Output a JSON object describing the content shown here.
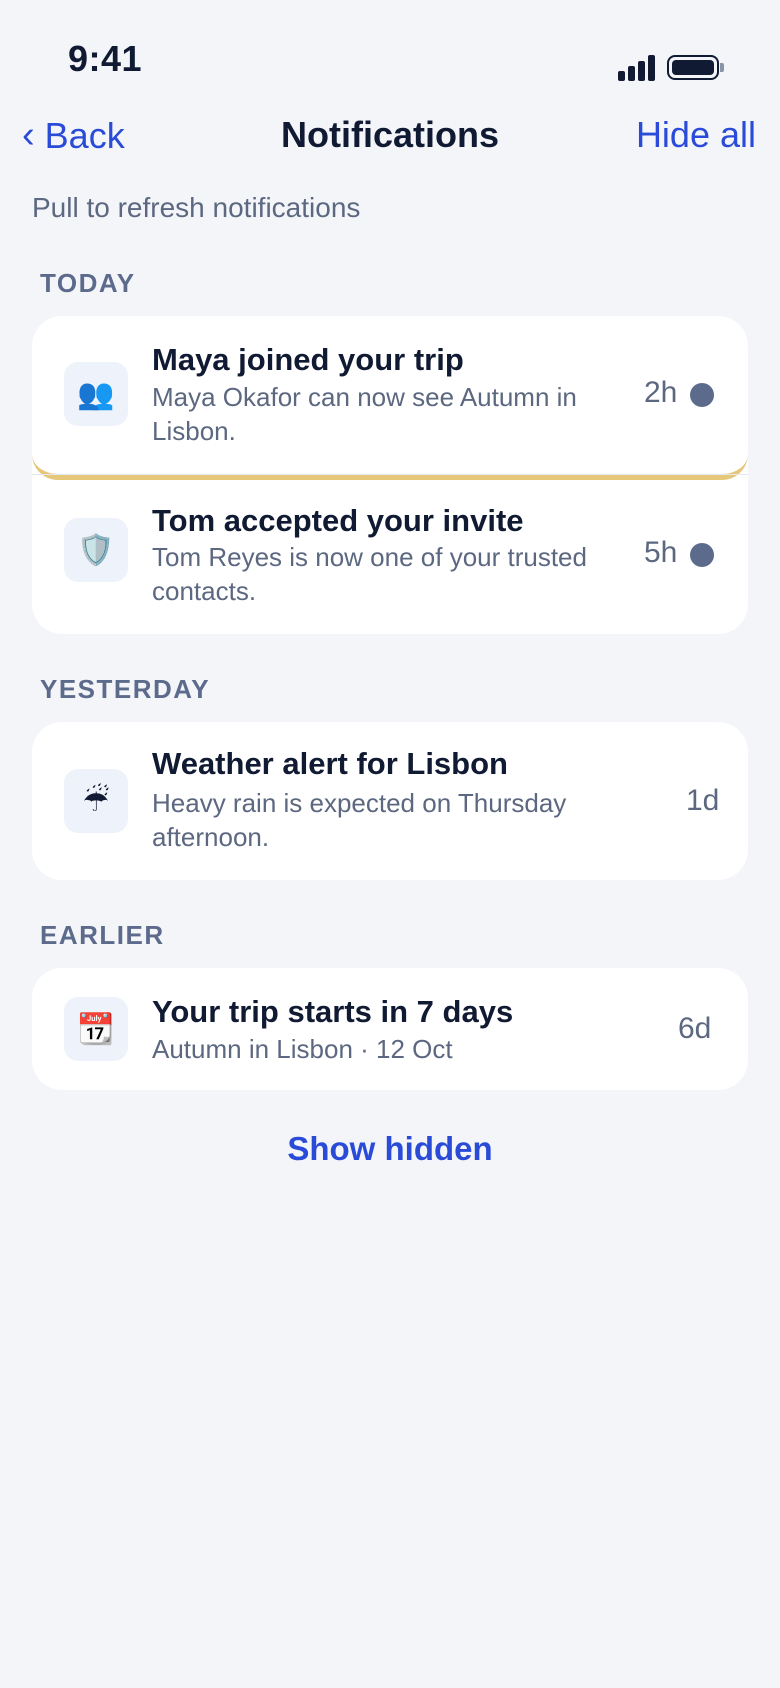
{
  "status_bar": {
    "time": "9:41",
    "signal_icon": "cellular-signal-icon",
    "battery_icon": "battery-icon"
  },
  "nav": {
    "back_label": "Back",
    "back_chevron": "‹",
    "title": "Notifications",
    "hide_all_label": "Hide all"
  },
  "refresh_hint": "Pull to refresh notifications",
  "sections": {
    "today": {
      "label": "TODAY",
      "items": [
        {
          "icon": "👥",
          "icon_name": "people-icon",
          "title": "Maya joined your trip",
          "body": "Maya Okafor can now see Autumn in Lisbon.",
          "time": "2h",
          "unread": true
        },
        {
          "icon": "🛡️",
          "icon_name": "shield-icon",
          "title": "Tom accepted your invite",
          "body": "Tom Reyes is now one of your trusted contacts.",
          "time": "5h",
          "unread": true
        }
      ]
    },
    "yesterday": {
      "label": "YESTERDAY",
      "items": [
        {
          "icon": "☔",
          "icon_name": "umbrella-rain-icon",
          "title": "Weather alert for Lisbon",
          "body": "Heavy rain is expected on Thursday afternoon.",
          "time": "1d",
          "unread": false
        }
      ]
    },
    "earlier": {
      "label": "EARLIER",
      "items": [
        {
          "icon": "📆",
          "icon_name": "calendar-icon",
          "title": "Your trip starts in 7 days",
          "body": "Autumn in Lisbon · 12 Oct",
          "time": "6d",
          "unread": false
        }
      ]
    }
  },
  "show_hidden_label": "Show hidden",
  "colors": {
    "accent": "#2a4bd8",
    "background": "#f3f5f9",
    "text_primary": "#111a33",
    "text_secondary": "#5c6780",
    "unread_dot": "#5c6a8c",
    "highlight": "#e6c77a"
  }
}
